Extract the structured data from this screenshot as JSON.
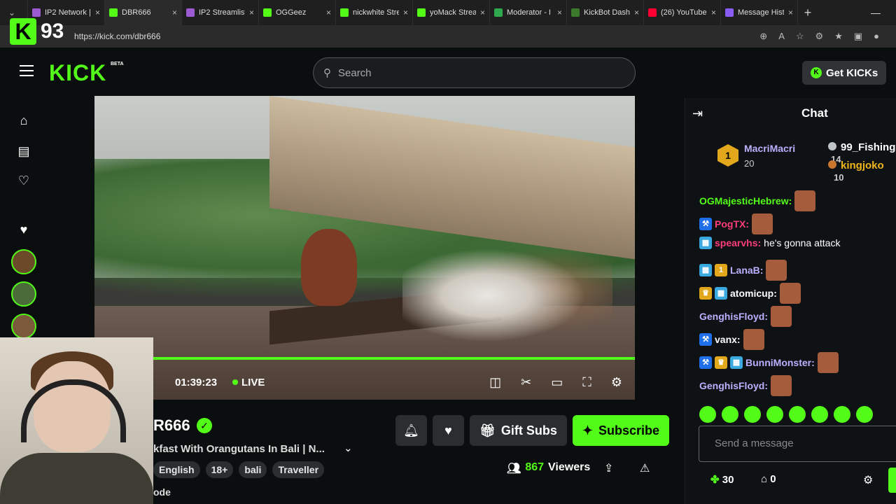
{
  "browser": {
    "tabs": [
      {
        "label": "IP2 Network | ...",
        "color": "#9c5bd1"
      },
      {
        "label": "DBR666",
        "color": "#53fc18"
      },
      {
        "label": "IP2 Streamlist",
        "color": "#9c5bd1"
      },
      {
        "label": "OGGeez",
        "color": "#53fc18"
      },
      {
        "label": "nickwhite Stre",
        "color": "#53fc18"
      },
      {
        "label": "yoMack Strea",
        "color": "#53fc18"
      },
      {
        "label": "Moderator - I",
        "color": "#2fa84f"
      },
      {
        "label": "KickBot Dash",
        "color": "#3b7a2a"
      },
      {
        "label": "(26) YouTube",
        "color": "#ff0033"
      },
      {
        "label": "Message Hist",
        "color": "#8a5cf6"
      }
    ],
    "url": "https://kick.com/dbr666"
  },
  "overlay": {
    "letter": "K",
    "count": "93"
  },
  "header": {
    "logo": "KICK",
    "beta": "BETA",
    "search_placeholder": "Search",
    "get_kicks": "Get KICKs"
  },
  "player": {
    "time": "01:39:23",
    "live_label": "LIVE"
  },
  "stream": {
    "channel": "R666",
    "title": "kfast With Orangutans In Bali | N...",
    "tags": [
      "English",
      "18+",
      "bali",
      "Traveller"
    ],
    "category": "ode",
    "viewers_count": "867",
    "viewers_label": "Viewers",
    "gift_subs": "Gift Subs",
    "subscribe": "Subscribe"
  },
  "chat": {
    "title": "Chat",
    "leaderboard": {
      "first": {
        "name": "MacriMacri",
        "count": "20",
        "rank": "1"
      },
      "second": {
        "name": "99_Fishing",
        "count": "14"
      },
      "third": {
        "name": "kingjoko",
        "count": "10"
      }
    },
    "messages": [
      {
        "user": "OGMajesticHebrew:",
        "color": "#53fc18",
        "text": ""
      },
      {
        "user": "PogTX:",
        "color": "#ff3d7a",
        "text": ""
      },
      {
        "user": "spearvhs:",
        "color": "#ff3d7a",
        "text": "he's gonna attack"
      },
      {
        "user": "LanaB:",
        "color": "#b9b0ff",
        "text": ""
      },
      {
        "user": "atomicup:",
        "color": "#fff",
        "text": ""
      },
      {
        "user": "GenghisFloyd:",
        "color": "#b9b0ff",
        "text": ""
      },
      {
        "user": "vanx:",
        "color": "#fff",
        "text": ""
      },
      {
        "user": "BunniMonster:",
        "color": "#b9b0ff",
        "text": ""
      },
      {
        "user": "GenghisFloyd:",
        "color": "#b9b0ff",
        "text": ""
      }
    ],
    "input_placeholder": "Send a message",
    "points": "30",
    "boxes": "0"
  }
}
